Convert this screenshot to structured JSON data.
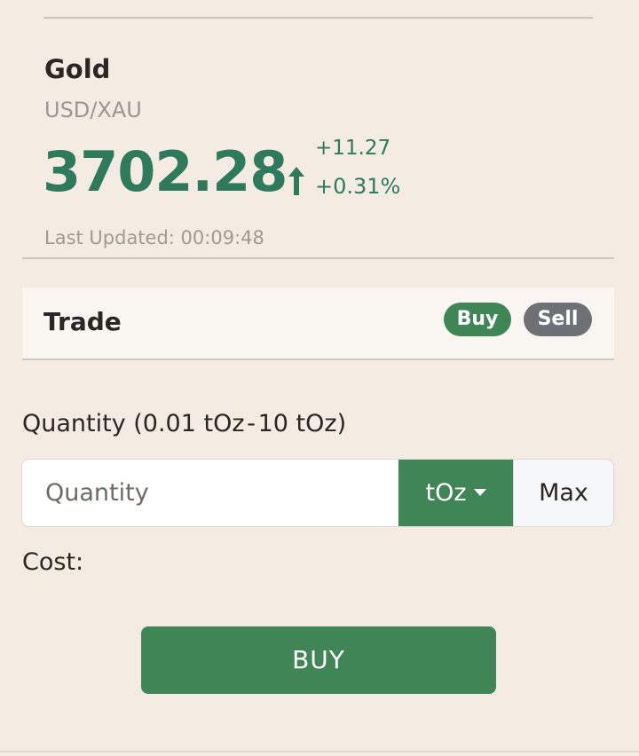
{
  "asset": {
    "name": "Gold",
    "pair": "USD/XAU",
    "price": "3702.28",
    "change_abs": "+11.27",
    "change_pct": "+0.31%",
    "last_updated": "Last Updated: 00:09:48",
    "trend": "up",
    "trend_icon": "arrow-up-icon"
  },
  "trade": {
    "title": "Trade",
    "buy_label": "Buy",
    "sell_label": "Sell",
    "selected_side": "Buy"
  },
  "quantity": {
    "label": "Quantity (0.01 tOz - 10 tOz)",
    "placeholder": "Quantity",
    "value": "",
    "unit": "tOz",
    "max_label": "Max"
  },
  "cost": {
    "label": "Cost:",
    "value": ""
  },
  "actions": {
    "buy_label": "BUY"
  },
  "colors": {
    "background": "#f4ece2",
    "accent_green": "#408556",
    "price_green": "#2f7a5c",
    "sell_gray": "#6d7175",
    "text_dark": "#2b2623",
    "text_muted": "#9b9690"
  }
}
